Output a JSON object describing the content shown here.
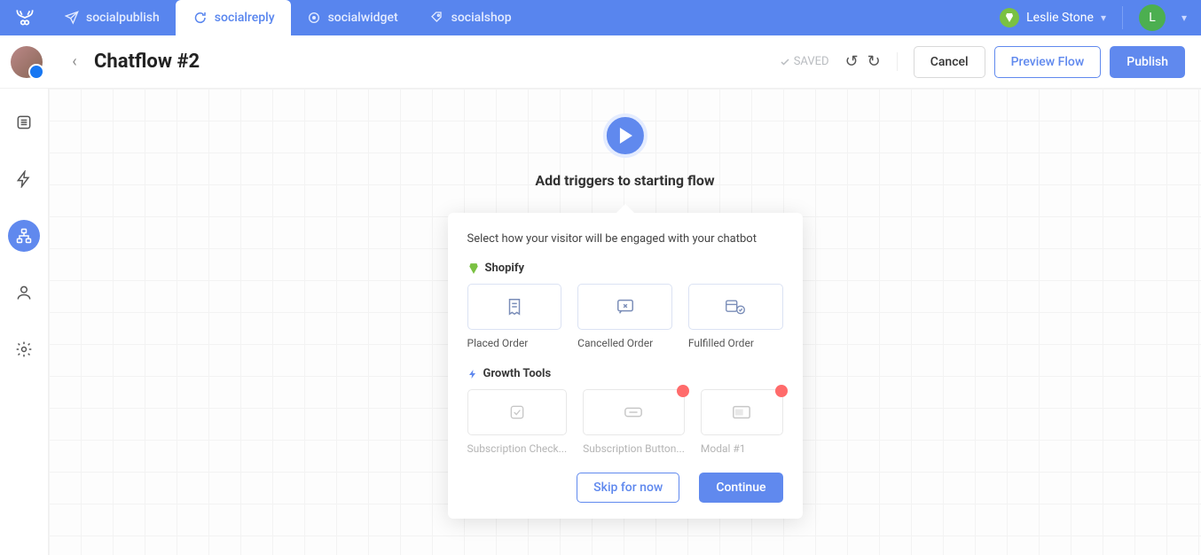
{
  "topnav": {
    "tabs": [
      "socialpublish",
      "socialreply",
      "socialwidget",
      "socialshop"
    ],
    "active_index": 1,
    "user_name": "Leslie Stone",
    "avatar_initial": "L"
  },
  "toolbar": {
    "page_title": "Chatflow #2",
    "saved_label": "SAVED",
    "cancel_label": "Cancel",
    "preview_label": "Preview Flow",
    "publish_label": "Publish"
  },
  "start_node": {
    "title": "Add triggers to starting flow"
  },
  "popover": {
    "description": "Select how your visitor will be engaged with your chatbot",
    "sections": [
      {
        "label": "Shopify",
        "icon": "shopify-bag-icon",
        "items": [
          {
            "label": "Placed Order",
            "icon": "receipt-icon",
            "enabled": true,
            "alert": false
          },
          {
            "label": "Cancelled Order",
            "icon": "comment-x-icon",
            "enabled": true,
            "alert": false
          },
          {
            "label": "Fulfilled Order",
            "icon": "package-check-icon",
            "enabled": true,
            "alert": false
          }
        ]
      },
      {
        "label": "Growth Tools",
        "icon": "bolt-icon",
        "items": [
          {
            "label": "Subscription Check...",
            "icon": "checkbox-icon",
            "enabled": false,
            "alert": false
          },
          {
            "label": "Subscription Button...",
            "icon": "button-icon",
            "enabled": false,
            "alert": true
          },
          {
            "label": "Modal #1",
            "icon": "modal-icon",
            "enabled": false,
            "alert": true
          }
        ]
      }
    ],
    "skip_label": "Skip for now",
    "continue_label": "Continue"
  }
}
